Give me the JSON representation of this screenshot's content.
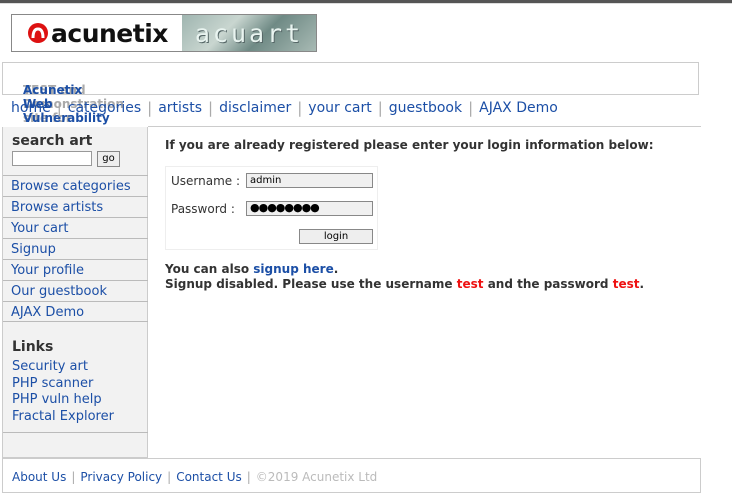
{
  "logo": {
    "brand": "acunetix",
    "product": "acuart"
  },
  "tagline": {
    "prefix": "TEST and Demonstration site for",
    "link": "Acunetix Web Vulnerability Scanner"
  },
  "topnav": [
    "home",
    "categories",
    "artists",
    "disclaimer",
    "your cart",
    "guestbook",
    "AJAX Demo"
  ],
  "sidebar": {
    "search_title": "search art",
    "search_value": "",
    "go_label": "go",
    "links": [
      "Browse categories",
      "Browse artists",
      "Your cart",
      "Signup",
      "Your profile",
      "Our guestbook",
      "AJAX Demo"
    ],
    "links_title": "Links",
    "extra_links": [
      "Security art",
      "PHP scanner",
      "PHP vuln help",
      "Fractal Explorer"
    ]
  },
  "main": {
    "heading": "If you are already registered please enter your login information below:",
    "username_label": "Username :",
    "username_value": "admin",
    "password_label": "Password :",
    "password_value": "●●●●●●●●",
    "login_label": "login",
    "also_prefix": "You can also",
    "signup_link": "signup here",
    "also_suffix": ".",
    "disabled_1": "Signup disabled. Please use the username",
    "test_user": "test",
    "disabled_2": "and the password",
    "test_pass": "test",
    "disabled_3": "."
  },
  "footer": {
    "links": [
      "About Us",
      "Privacy Policy",
      "Contact Us"
    ],
    "copyright": "©2019 Acunetix Ltd"
  },
  "colors": {
    "link": "#1c4fa6",
    "highlight": "#e11111",
    "sidebar_bg": "#f2f2f2"
  }
}
